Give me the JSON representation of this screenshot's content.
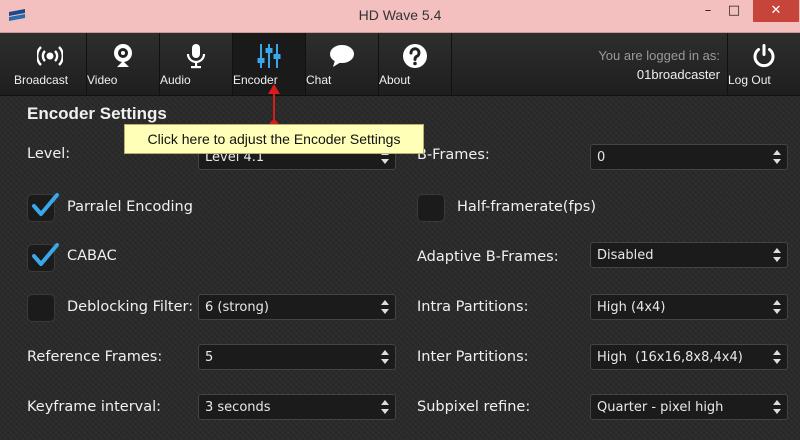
{
  "window": {
    "title": "HD Wave 5.4",
    "minimize": "–",
    "maximize": "□",
    "close": "✕",
    "app_icon": "app-logo-icon"
  },
  "nav": {
    "items": [
      {
        "label": "Broadcast",
        "icon": "broadcast-icon"
      },
      {
        "label": "Video",
        "icon": "webcam-icon"
      },
      {
        "label": "Audio",
        "icon": "microphone-icon"
      },
      {
        "label": "Encoder",
        "icon": "sliders-icon",
        "active": true
      },
      {
        "label": "Chat",
        "icon": "chat-bubble-icon"
      },
      {
        "label": "About",
        "icon": "question-icon"
      }
    ],
    "logged_in_label": "You are logged in as:",
    "username": "01broadcaster",
    "logout_label": "Log Out",
    "accent": "#3aa7e8"
  },
  "encoder": {
    "title": "Encoder Settings",
    "tooltip": "Click here to adjust the Encoder Settings",
    "level": {
      "label": "Level:",
      "value": "Level 4.1"
    },
    "parallel_encoding": {
      "label": "Parralel Encoding",
      "checked": true
    },
    "cabac": {
      "label": "CABAC",
      "checked": true
    },
    "deblocking": {
      "label": "Deblocking Filter:",
      "checked": false,
      "value": "6 (strong)"
    },
    "reference_frames": {
      "label": "Reference Frames:",
      "value": "5"
    },
    "keyframe_interval": {
      "label": "Keyframe interval:",
      "value": "3  seconds"
    },
    "b_frames": {
      "label": "B-Frames:",
      "value": "0"
    },
    "half_framerate": {
      "label": "Half-framerate(fps)",
      "checked": false
    },
    "adaptive_b_frames": {
      "label": "Adaptive B-Frames:",
      "value": "Disabled"
    },
    "intra_partitions": {
      "label": "Intra Partitions:",
      "value": "High (4x4)"
    },
    "inter_partitions": {
      "label": "Inter Partitions:",
      "value": "High  (16x16,8x8,4x4)"
    },
    "subpixel_refine": {
      "label": "Subpixel refine:",
      "value": "Quarter - pixel high"
    }
  }
}
